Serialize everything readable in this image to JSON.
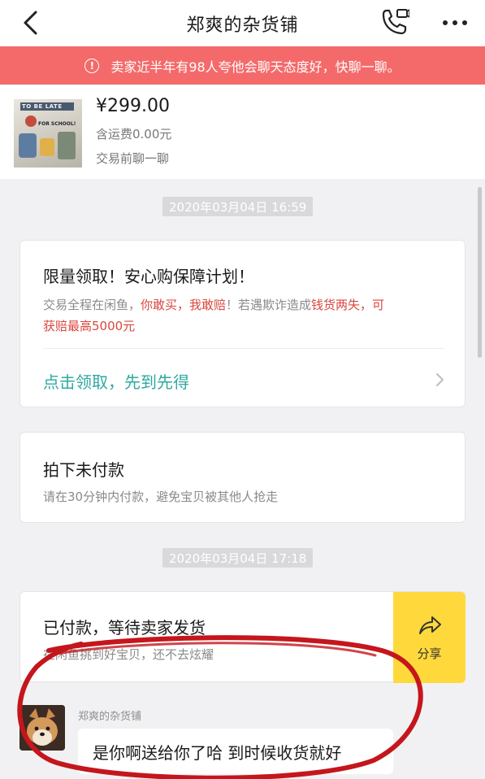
{
  "header": {
    "title": "郑爽的杂货铺",
    "back_icon": "chevron-left-icon",
    "phone_icon": "phone-icon",
    "more_icon": "more-dots-icon"
  },
  "notice": {
    "text": "卖家近半年有98人夸他会聊天态度好，快聊一聊。",
    "icon": "info-icon",
    "color": "#f46a6a"
  },
  "product": {
    "thumb_text_top": "TO BE LATE",
    "thumb_text_bottom": "FOR SCHOOL!",
    "price": "¥299.00",
    "shipping": "含运费0.00元",
    "chat_first": "交易前聊一聊"
  },
  "timestamps": [
    "2020年03月04日 16:59",
    "2020年03月04日 17:18"
  ],
  "protection_card": {
    "title": "限量领取！安心购保障计划！",
    "line1_a": "交易全程在闲鱼，",
    "line1_b": "你敢买，我敢赔",
    "line1_c": "！若遇欺诈造成",
    "line1_d": "钱货两失，可",
    "line2": "获赔最高5000元",
    "link": "点击领取，先到先得",
    "link_color": "#2fa9a0",
    "highlight_color": "#d9473f"
  },
  "unpaid_card": {
    "title": "拍下未付款",
    "subtitle": "请在30分钟内付款，避免宝贝被其他人抢走"
  },
  "paid_card": {
    "title": "已付款，等待卖家发货",
    "subtitle": "在闲鱼挑到好宝贝，还不去炫耀",
    "share_label": "分享",
    "share_color": "#ffd93b"
  },
  "chat": {
    "sender": "郑爽的杂货铺",
    "message": "是你啊送给你了哈 到时候收货就好"
  },
  "annotation_color": "#c4161c"
}
